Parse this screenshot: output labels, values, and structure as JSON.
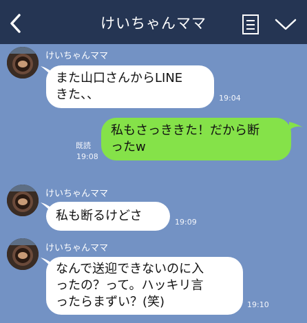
{
  "header": {
    "title": "けいちゃんママ"
  },
  "messages": [
    {
      "sender": "けいちゃんママ",
      "text": "また山口さんからLINE\nきた、、",
      "time": "19:04"
    },
    {
      "text": "私もさっききた！だから断\nったw",
      "read": "既読",
      "time": "19:08"
    },
    {
      "sender": "けいちゃんママ",
      "text": "私も断るけどさ",
      "time": "19:09"
    },
    {
      "sender": "けいちゃんママ",
      "text": "なんで送迎できないのに入\nったの？って。ハッキリ言\nったらまずい？(笑)",
      "time": "19:10"
    }
  ],
  "colors": {
    "background": "#7392c4",
    "header": "#253553",
    "incoming_bubble": "#ffffff",
    "outgoing_bubble": "#85e249"
  },
  "icons": [
    "back-chevron-icon",
    "note-menu-icon",
    "chevron-down-icon"
  ]
}
